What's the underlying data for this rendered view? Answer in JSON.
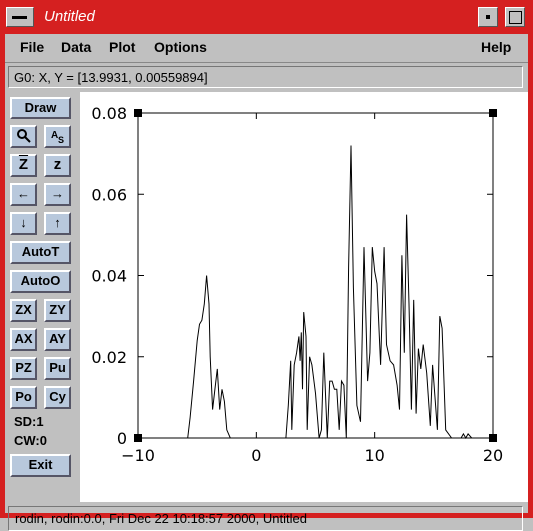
{
  "window": {
    "title": "Untitled"
  },
  "menubar": {
    "items": [
      "File",
      "Data",
      "Plot",
      "Options"
    ],
    "help": "Help"
  },
  "status": {
    "coords": "G0: X, Y = [13.9931, 0.00559894]"
  },
  "toolbar": {
    "draw": "Draw",
    "zoom_in": "Z",
    "zoom_out": "z",
    "autot": "AutoT",
    "autoo": "AutoO",
    "zx": "ZX",
    "zy": "ZY",
    "ax": "AX",
    "ay": "AY",
    "pz": "PZ",
    "pu": "Pu",
    "po": "Po",
    "cy": "Cy",
    "sd": "SD:1",
    "cw": "CW:0",
    "exit": "Exit"
  },
  "footer": {
    "text": "rodin, rodin:0.0, Fri Dec 22 10:18:57 2000, Untitled"
  },
  "chart_data": {
    "type": "line",
    "xlim": [
      -10,
      20
    ],
    "ylim": [
      0,
      0.08
    ],
    "xticks": [
      "−10",
      "0",
      "10",
      "20"
    ],
    "yticks": [
      "0",
      "0.02",
      "0.04",
      "0.06",
      "0.08"
    ],
    "xticks_v": [
      -10,
      0,
      10,
      20
    ],
    "yticks_v": [
      0,
      0.02,
      0.04,
      0.06,
      0.08
    ],
    "grid": false,
    "x": [
      -10,
      -5.8,
      -5.6,
      -5.3,
      -5.0,
      -4.8,
      -4.6,
      -4.4,
      -4.2,
      -4.0,
      -3.9,
      -3.7,
      -3.5,
      -3.3,
      -3.1,
      -2.9,
      -2.7,
      -2.5,
      -2.2,
      -1.8,
      0,
      2.5,
      2.7,
      2.9,
      3.0,
      3.2,
      3.4,
      3.6,
      3.7,
      3.8,
      3.9,
      4.0,
      4.2,
      4.3,
      4.5,
      4.7,
      5.0,
      5.3,
      5.5,
      5.7,
      6.0,
      6.2,
      6.4,
      6.6,
      6.8,
      7.0,
      7.2,
      7.4,
      7.6,
      7.8,
      8.0,
      8.2,
      8.5,
      8.8,
      9.1,
      9.4,
      9.6,
      9.8,
      10.0,
      10.2,
      10.5,
      10.8,
      11.0,
      11.3,
      11.6,
      11.9,
      12.1,
      12.3,
      12.5,
      12.7,
      12.9,
      13.1,
      13.3,
      13.5,
      13.7,
      13.9,
      14.1,
      14.4,
      14.7,
      14.9,
      15.1,
      15.3,
      15.5,
      15.7,
      16.0,
      16.5,
      17.0,
      17.3,
      17.5,
      17.7,
      17.9,
      18.2,
      20
    ],
    "y": [
      0,
      0,
      0.005,
      0.014,
      0.024,
      0.028,
      0.029,
      0.033,
      0.04,
      0.033,
      0.02,
      0.007,
      0.012,
      0.017,
      0.007,
      0.012,
      0.009,
      0.002,
      0,
      0,
      0,
      0,
      0.008,
      0.019,
      0.002,
      0.018,
      0.021,
      0.025,
      0.019,
      0.026,
      0.012,
      0.031,
      0.025,
      0.002,
      0.02,
      0.018,
      0.011,
      0,
      0.002,
      0.021,
      0,
      0.014,
      0.014,
      0.012,
      0.012,
      0.002,
      0.014,
      0.013,
      0.0,
      0.042,
      0.072,
      0.037,
      0.008,
      0.004,
      0.047,
      0.014,
      0.021,
      0.047,
      0.041,
      0.038,
      0.018,
      0.047,
      0.023,
      0.019,
      0.018,
      0.013,
      0.007,
      0.045,
      0.021,
      0.055,
      0.033,
      0.007,
      0.034,
      0.006,
      0.022,
      0.017,
      0.023,
      0.016,
      0.003,
      0.018,
      0.01,
      0.002,
      0.03,
      0.027,
      0.002,
      0,
      0,
      0,
      0.001,
      0,
      0.001,
      0,
      0
    ]
  }
}
